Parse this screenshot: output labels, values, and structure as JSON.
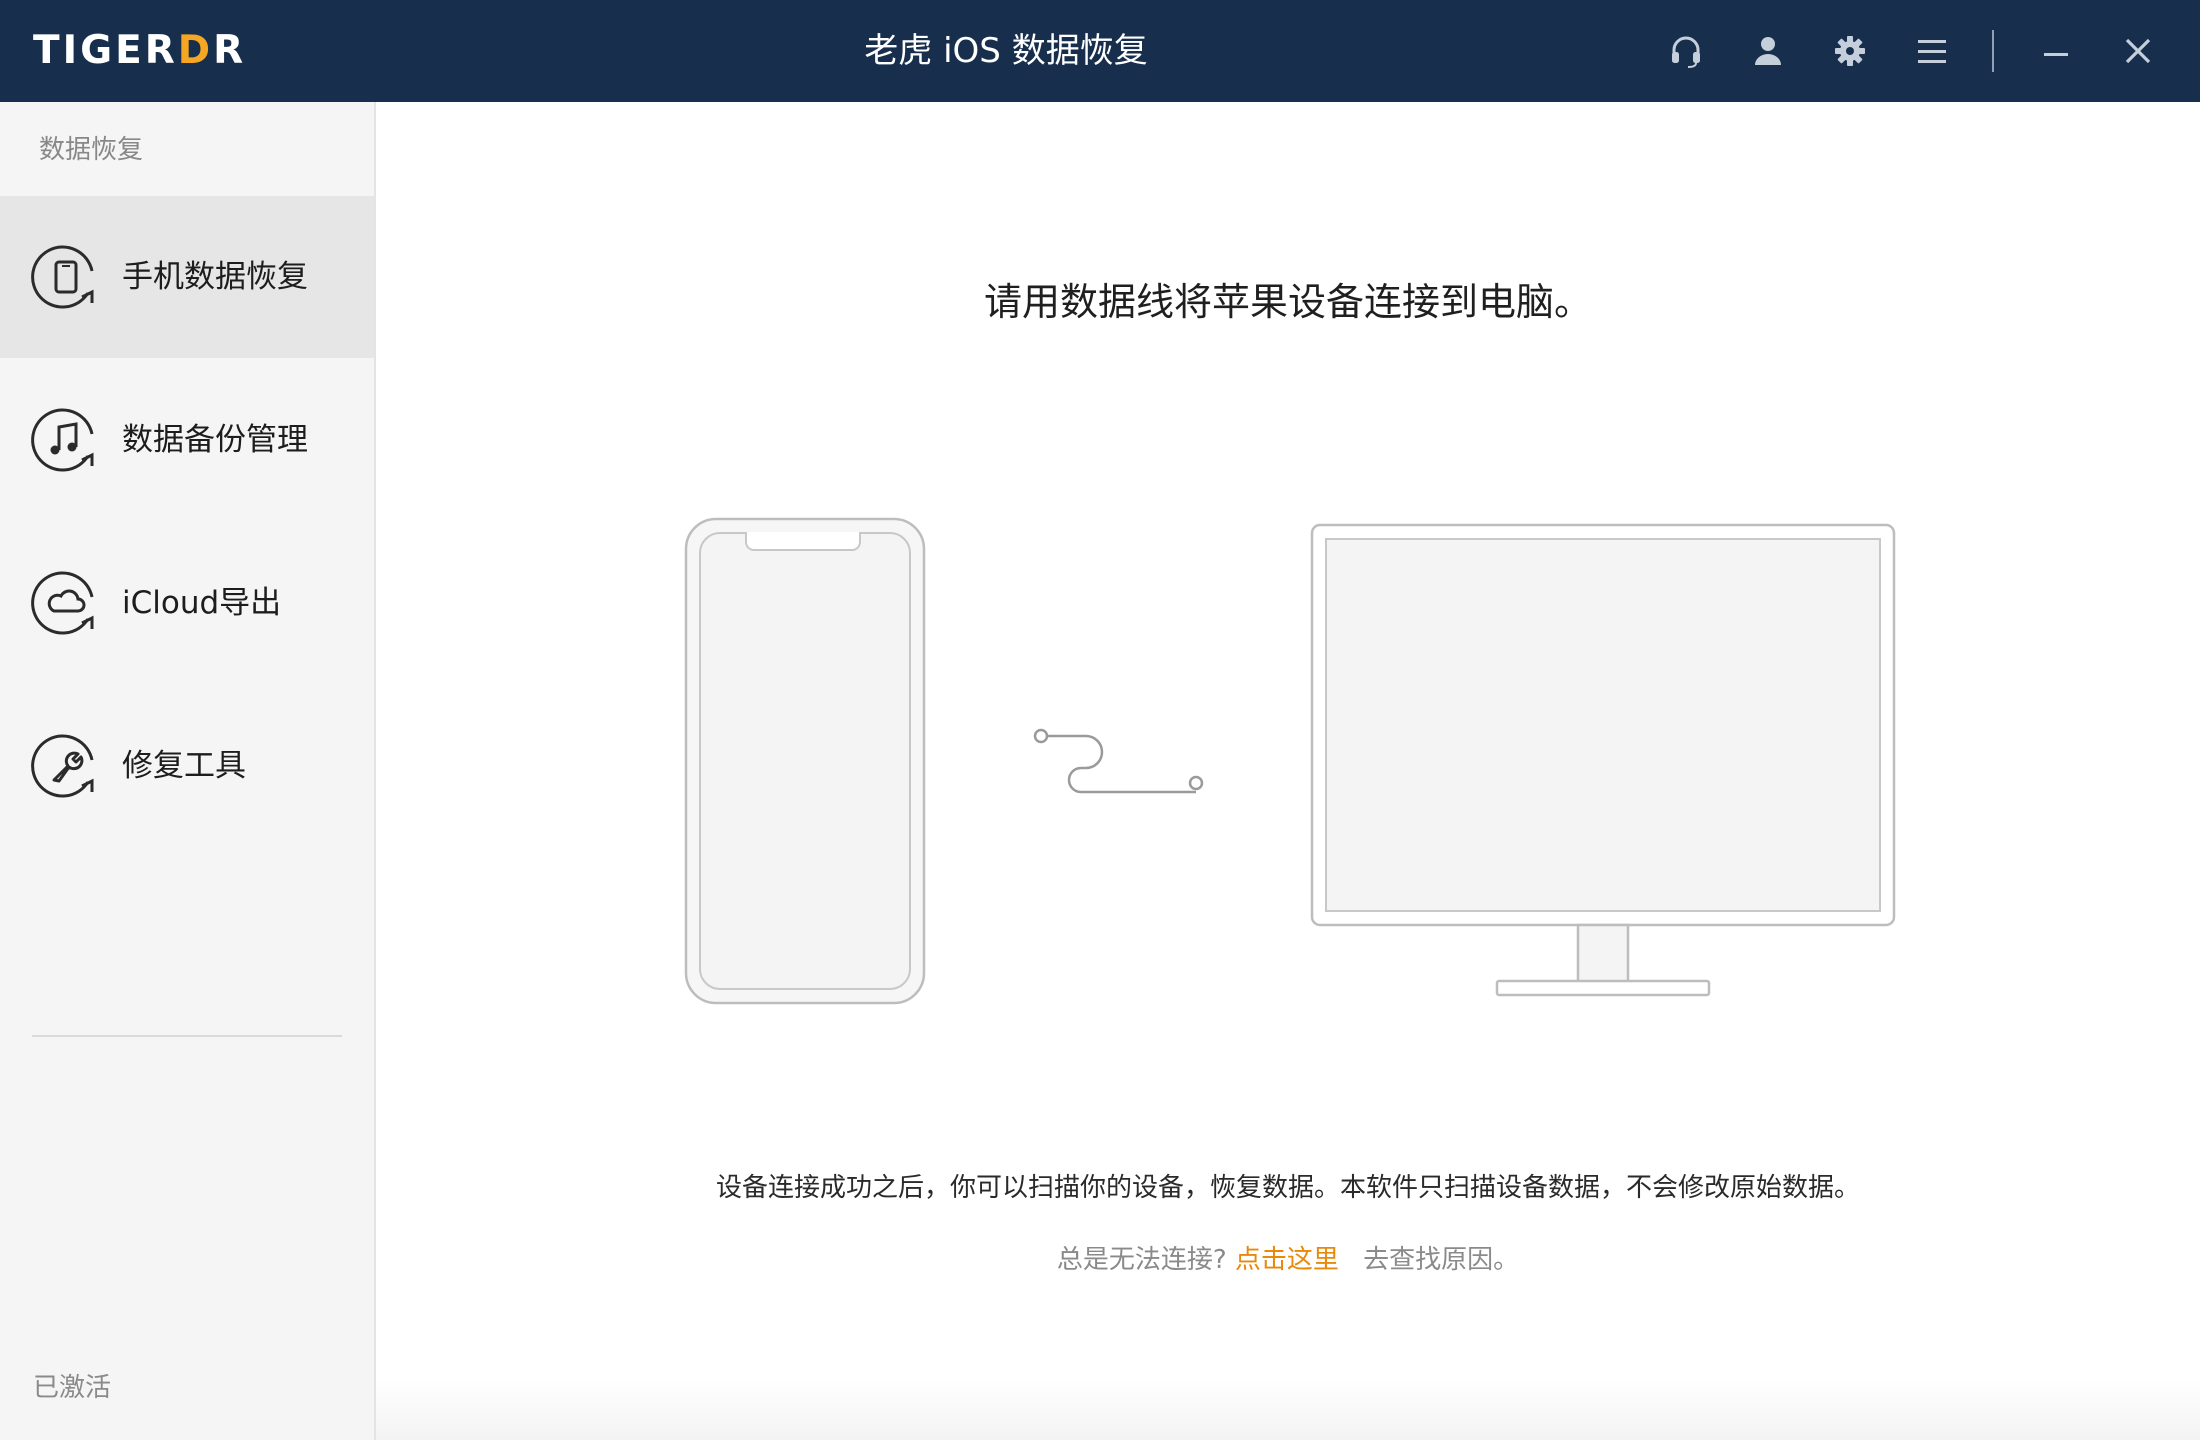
{
  "window": {
    "logo_prefix": "TIGER",
    "logo_accent": "D",
    "logo_suffix": "R",
    "title": "老虎 iOS 数据恢复",
    "controls": [
      "headset-icon",
      "user-icon",
      "gear-icon",
      "menu-icon",
      "minimize-icon",
      "close-icon"
    ]
  },
  "sidebar": {
    "section_title": "数据恢复",
    "items": [
      {
        "label": "手机数据恢复",
        "icon": "phone-recovery-icon",
        "active": true
      },
      {
        "label": "数据备份管理",
        "icon": "music-backup-icon",
        "active": false
      },
      {
        "label": "iCloud导出",
        "icon": "cloud-export-icon",
        "active": false
      },
      {
        "label": "修复工具",
        "icon": "wrench-repair-icon",
        "active": false
      }
    ],
    "status": "已激活"
  },
  "main": {
    "headline": "请用数据线将苹果设备连接到电脑。",
    "description": "设备连接成功之后，你可以扫描你的设备，恢复数据。本软件只扫描设备数据，不会修改原始数据。",
    "help_prefix": "总是无法连接?",
    "help_link": "点击这里",
    "help_suffix": "去查找原因。"
  },
  "colors": {
    "titlebar": "#172f4d",
    "accent": "#f5a623",
    "link": "#e8890c",
    "sidebar_bg": "#f5f5f5",
    "sidebar_active": "#e6e6e6"
  }
}
